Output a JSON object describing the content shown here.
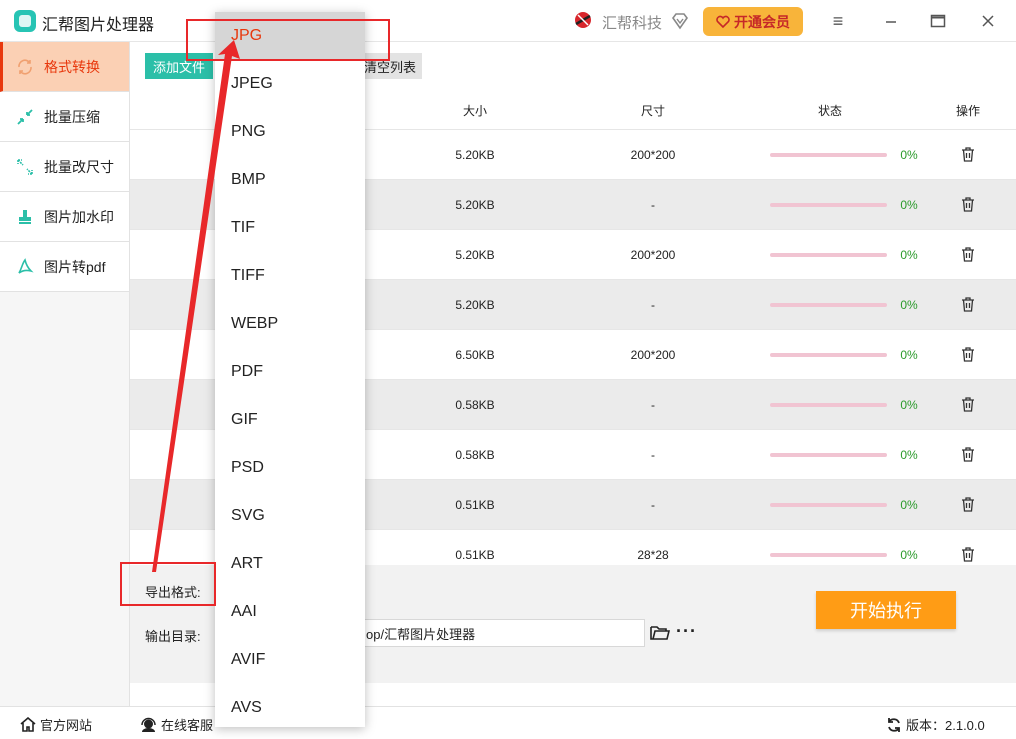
{
  "app": {
    "title": "汇帮图片处理器"
  },
  "header": {
    "brand": "汇帮科技",
    "vip_label": "开通会员",
    "minimize_icon": "≡",
    "maximize_icon": "□",
    "close_icon": "✕"
  },
  "sidebar": {
    "items": [
      {
        "label": "格式转换",
        "icon": "refresh-icon",
        "active": true
      },
      {
        "label": "批量压缩",
        "icon": "compress-icon",
        "active": false
      },
      {
        "label": "批量改尺寸",
        "icon": "resize-icon",
        "active": false
      },
      {
        "label": "图片加水印",
        "icon": "stamp-icon",
        "active": false
      },
      {
        "label": "图片转pdf",
        "icon": "pdf-icon",
        "active": false
      }
    ]
  },
  "toolbar": {
    "add_label": "添加文件",
    "clear_label": "清空列表"
  },
  "table": {
    "headers": {
      "size": "大小",
      "dimension": "尺寸",
      "status": "状态",
      "action": "操作"
    },
    "rows": [
      {
        "size": "5.20KB",
        "dimension": "200*200",
        "progress": "0%"
      },
      {
        "size": "5.20KB",
        "dimension": "-",
        "progress": "0%"
      },
      {
        "size": "5.20KB",
        "dimension": "200*200",
        "progress": "0%"
      },
      {
        "size": "5.20KB",
        "dimension": "-",
        "progress": "0%"
      },
      {
        "size": "6.50KB",
        "dimension": "200*200",
        "progress": "0%"
      },
      {
        "size": "0.58KB",
        "dimension": "-",
        "progress": "0%"
      },
      {
        "size": "0.58KB",
        "dimension": "-",
        "progress": "0%"
      },
      {
        "size": "0.51KB",
        "dimension": "-",
        "progress": "0%"
      },
      {
        "size": "0.51KB",
        "dimension": "28*28",
        "progress": "0%"
      }
    ]
  },
  "settings": {
    "format_label": "导出格式:",
    "output_label": "输出目录:",
    "output_path_visible": "op/汇帮图片处理器",
    "more_label": "···",
    "start_label": "开始执行"
  },
  "statusbar": {
    "website_label": "官方网站",
    "support_label": "在线客服",
    "version_label": "版本：2.1.0.0"
  },
  "dropdown": {
    "selected": "JPG",
    "options": [
      "JPG",
      "JPEG",
      "PNG",
      "BMP",
      "TIF",
      "TIFF",
      "WEBP",
      "PDF",
      "GIF",
      "PSD",
      "SVG",
      "ART",
      "AAI",
      "AVIF",
      "AVS"
    ]
  },
  "colors": {
    "accent_teal": "#2bbfa8",
    "active_red": "#e8380d",
    "orange": "#ff9c15",
    "annotation_red": "#e8282a",
    "progress_green": "#2a9a2a"
  }
}
